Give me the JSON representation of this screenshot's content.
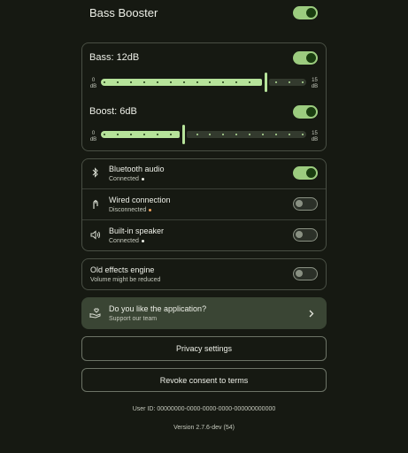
{
  "header": {
    "title": "Bass Booster",
    "enabled": true
  },
  "bass": {
    "label": "Bass: 12dB",
    "enabled": true,
    "value_db": 12,
    "min_label": [
      "0",
      "dB"
    ],
    "max_label": [
      "15",
      "dB"
    ],
    "range": [
      0,
      15
    ]
  },
  "boost": {
    "label": "Boost: 6dB",
    "enabled": true,
    "value_db": 6,
    "min_label": [
      "0",
      "dB"
    ],
    "max_label": [
      "15",
      "dB"
    ],
    "range": [
      0,
      15
    ]
  },
  "outputs": [
    {
      "title": "Bluetooth audio",
      "status": "Connected",
      "status_color": "#e8ebe2",
      "enabled": true,
      "icon": "bluetooth-icon"
    },
    {
      "title": "Wired connection",
      "status": "Disconnected",
      "status_color": "#f0a35e",
      "enabled": false,
      "icon": "cable-icon"
    },
    {
      "title": "Built-in speaker",
      "status": "Connected",
      "status_color": "#e8ebe2",
      "enabled": false,
      "icon": "speaker-icon"
    }
  ],
  "old_engine": {
    "title": "Old effects engine",
    "subtitle": "Volume might be reduced",
    "enabled": false
  },
  "support": {
    "title": "Do you like the application?",
    "subtitle": "Support our team",
    "icon": "hand-heart-icon",
    "chevron": "chevron-right-icon"
  },
  "buttons": {
    "privacy": "Privacy settings",
    "revoke": "Revoke consent to terms"
  },
  "footer": {
    "user_id": "User ID: 00000000-0000-0000-0000-000000000000",
    "version": "Version 2.7.6-dev (54)"
  },
  "colors": {
    "accent": "#9ccc7f",
    "background": "#161912",
    "support_bg": "#3a4534"
  }
}
